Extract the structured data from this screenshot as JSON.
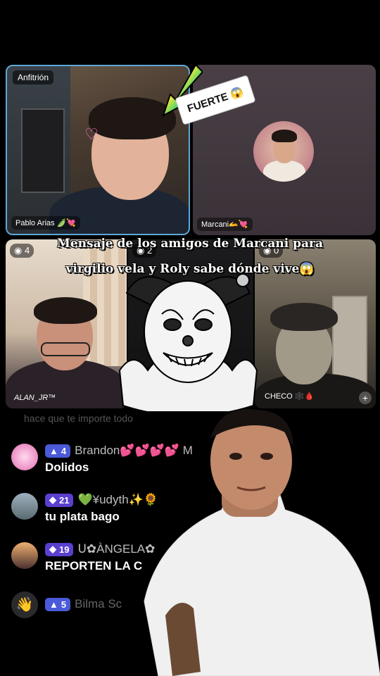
{
  "host_tile": {
    "badge": "Anfitrión",
    "name": "Pablo Arias 🫛💘"
  },
  "sticker": {
    "text": "FUERTE 😱"
  },
  "marcani_tile": {
    "name": "Marcani🫴💘"
  },
  "alan_tile": {
    "count": "4",
    "name": "ALAN_JR™"
  },
  "mid_tile": {
    "count": "2"
  },
  "checo_tile": {
    "count": "0",
    "name": "CHECO 🕸️🩸",
    "plus": "+"
  },
  "caption": {
    "line1": "Mensaje de los amigos de Marcani para",
    "line2": "virgilio vela y Roly sabe dónde vive😱"
  },
  "comments": {
    "faded": "hace que te importe todo",
    "items": [
      {
        "level": "4",
        "username": "Brandon💕💕💕💕 M",
        "text": "Dolidos",
        "badge_color": "#4a5ad8"
      },
      {
        "level": "21",
        "username": "💚¥udyth✨🌻",
        "text": "tu plata bago",
        "badge_color": "#5a3fd0"
      },
      {
        "level": "19",
        "username": "ᑌ✿ÀNGELA✿",
        "text": "REPORTEN LA C",
        "badge_color": "#5a3fd0"
      },
      {
        "level": "5",
        "username": "Bilma Sc",
        "text": "",
        "badge_color": "#4a5ad8"
      }
    ]
  },
  "icons": {
    "level_badge": "triangle-icon",
    "level_badge_high": "diamond-icon",
    "mic_muted": "mic-off-icon",
    "wave": "wave-hand-icon"
  }
}
